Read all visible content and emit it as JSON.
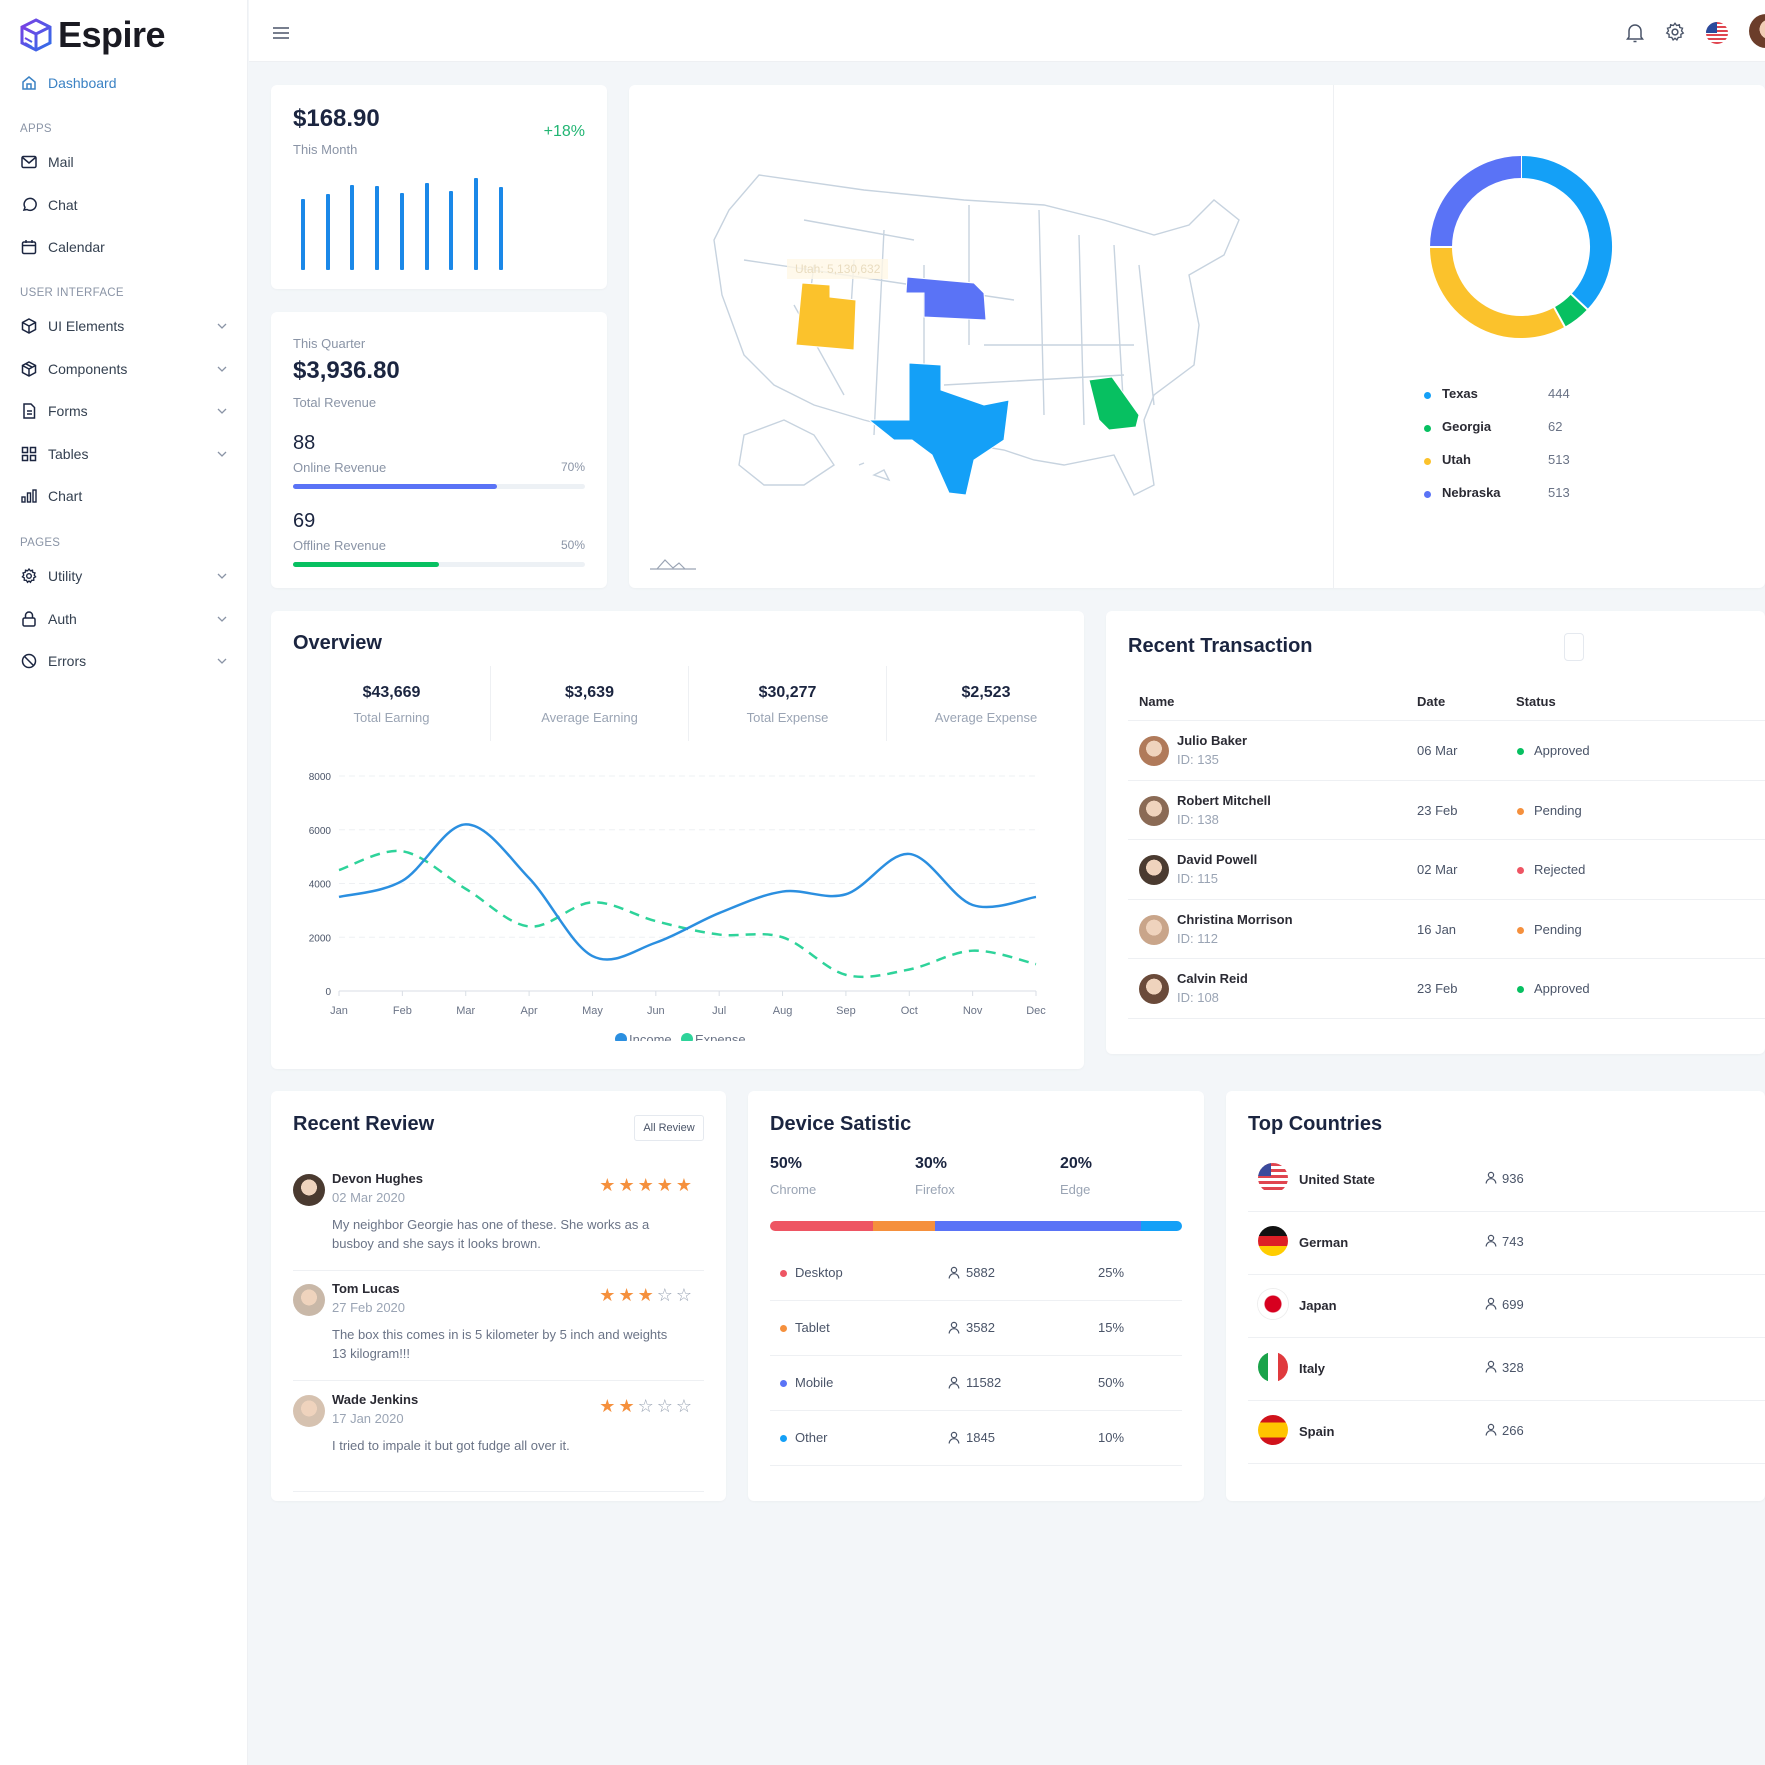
{
  "app": {
    "name": "Espire"
  },
  "sidebar": {
    "dashboard": "Dashboard",
    "sections": {
      "apps": "APPS",
      "ui": "USER INTERFACE",
      "pages": "PAGES"
    },
    "items": [
      {
        "label": "Mail",
        "icon": "mail-icon"
      },
      {
        "label": "Chat",
        "icon": "chat-icon"
      },
      {
        "label": "Calendar",
        "icon": "calendar-icon"
      },
      {
        "label": "UI Elements",
        "icon": "cube-icon"
      },
      {
        "label": "Components",
        "icon": "box-icon"
      },
      {
        "label": "Forms",
        "icon": "document-icon"
      },
      {
        "label": "Tables",
        "icon": "grid-icon"
      },
      {
        "label": "Chart",
        "icon": "bar-chart-icon"
      },
      {
        "label": "Utility",
        "icon": "gear-icon"
      },
      {
        "label": "Auth",
        "icon": "lock-icon"
      },
      {
        "label": "Errors",
        "icon": "ban-icon"
      }
    ]
  },
  "header": {
    "icons": [
      "menu-icon",
      "bell-icon",
      "gear-icon",
      "us-flag-icon",
      "user-avatar"
    ]
  },
  "month_card": {
    "value": "$168.90",
    "label": "This Month",
    "change": "+18%",
    "bars": [
      52,
      56,
      63,
      62,
      57,
      64,
      58,
      68,
      61
    ]
  },
  "quarter_card": {
    "label": "This Quarter",
    "value": "$3,936.80",
    "sub": "Total Revenue",
    "online": {
      "value": "88",
      "label": "Online Revenue",
      "percent": "70%",
      "fraction": 0.7
    },
    "offline": {
      "value": "69",
      "label": "Offline Revenue",
      "percent": "50%",
      "fraction": 0.5
    }
  },
  "map_card": {
    "tooltip": "Utah: 5,130,632",
    "legend": [
      {
        "name": "Texas",
        "value": "444",
        "color": "#14a0f7"
      },
      {
        "name": "Georgia",
        "value": "62",
        "color": "#07c061"
      },
      {
        "name": "Utah",
        "value": "513",
        "color": "#fbc22c"
      },
      {
        "name": "Nebraska",
        "value": "513",
        "color": "#5a73f6"
      }
    ]
  },
  "overview": {
    "title": "Overview",
    "stats": [
      {
        "value": "$43,669",
        "label": "Total Earning"
      },
      {
        "value": "$3,639",
        "label": "Average Earning"
      },
      {
        "value": "$30,277",
        "label": "Total Expense"
      },
      {
        "value": "$2,523",
        "label": "Average Expense"
      }
    ]
  },
  "chart_data": {
    "type": "line",
    "title": "",
    "xlabel": "",
    "ylabel": "",
    "x": [
      "Jan",
      "Feb",
      "Mar",
      "Apr",
      "May",
      "Jun",
      "Jul",
      "Aug",
      "Sep",
      "Oct",
      "Nov",
      "Dec"
    ],
    "ylim": [
      0,
      8000
    ],
    "yticks": [
      "0",
      "2000",
      "4000",
      "6000",
      "8000"
    ],
    "grid": true,
    "legend": "bottom",
    "series": [
      {
        "name": "Income",
        "color": "#2b8fe0",
        "style": "solid",
        "values": [
          3500,
          4100,
          6200,
          4200,
          1300,
          1800,
          2900,
          3700,
          3600,
          5100,
          3200,
          3500
        ]
      },
      {
        "name": "Expense",
        "color": "#2ed39a",
        "style": "dashed",
        "values": [
          4500,
          5200,
          3800,
          2400,
          3300,
          2600,
          2100,
          2000,
          600,
          800,
          1500,
          1000
        ]
      }
    ]
  },
  "transactions": {
    "title": "Recent Transaction",
    "columns": [
      "Name",
      "Date",
      "Status"
    ],
    "rows": [
      {
        "name": "Julio Baker",
        "id": "ID: 135",
        "date": "06 Mar",
        "status": "Approved",
        "color": "#07c061"
      },
      {
        "name": "Robert Mitchell",
        "id": "ID: 138",
        "date": "23 Feb",
        "status": "Pending",
        "color": "#f5903d"
      },
      {
        "name": "David Powell",
        "id": "ID: 115",
        "date": "02 Mar",
        "status": "Rejected",
        "color": "#ee5563"
      },
      {
        "name": "Christina Morrison",
        "id": "ID: 112",
        "date": "16 Jan",
        "status": "Pending",
        "color": "#f5903d"
      },
      {
        "name": "Calvin Reid",
        "id": "ID: 108",
        "date": "23 Feb",
        "status": "Approved",
        "color": "#07c061"
      }
    ]
  },
  "reviews": {
    "title": "Recent Review",
    "button": "All Review",
    "items": [
      {
        "name": "Devon Hughes",
        "date": "02 Mar 2020",
        "text": "My neighbor Georgie has one of these. She works as a busboy and she says it looks brown.",
        "rating": 5
      },
      {
        "name": "Tom Lucas",
        "date": "27 Feb 2020",
        "text": "The box this comes in is 5 kilometer by 5 inch and weights 13 kilogram!!!",
        "rating": 3
      },
      {
        "name": "Wade Jenkins",
        "date": "17 Jan 2020",
        "text": "I tried to impale it but got fudge all over it.",
        "rating": 2
      }
    ]
  },
  "devices": {
    "title": "Device Satistic",
    "browsers": [
      {
        "value": "50%",
        "label": "Chrome"
      },
      {
        "value": "30%",
        "label": "Firefox"
      },
      {
        "value": "20%",
        "label": "Edge"
      }
    ],
    "bar": [
      {
        "share": 0.25,
        "color": "#ee5563"
      },
      {
        "share": 0.15,
        "color": "#f5903d"
      },
      {
        "share": 0.5,
        "color": "#5a73f6"
      },
      {
        "share": 0.1,
        "color": "#14a0f7"
      }
    ],
    "rows": [
      {
        "name": "Desktop",
        "users": "5882",
        "percent": "25%",
        "color": "#ee5563"
      },
      {
        "name": "Tablet",
        "users": "3582",
        "percent": "15%",
        "color": "#f5903d"
      },
      {
        "name": "Mobile",
        "users": "11582",
        "percent": "50%",
        "color": "#5a73f6"
      },
      {
        "name": "Other",
        "users": "1845",
        "percent": "10%",
        "color": "#14a0f7"
      }
    ]
  },
  "countries": {
    "title": "Top Countries",
    "rows": [
      {
        "name": "United State",
        "users": "936",
        "flag": "us"
      },
      {
        "name": "German",
        "users": "743",
        "flag": "de"
      },
      {
        "name": "Japan",
        "users": "699",
        "flag": "jp"
      },
      {
        "name": "Italy",
        "users": "328",
        "flag": "it"
      },
      {
        "name": "Spain",
        "users": "266",
        "flag": "es"
      }
    ]
  }
}
